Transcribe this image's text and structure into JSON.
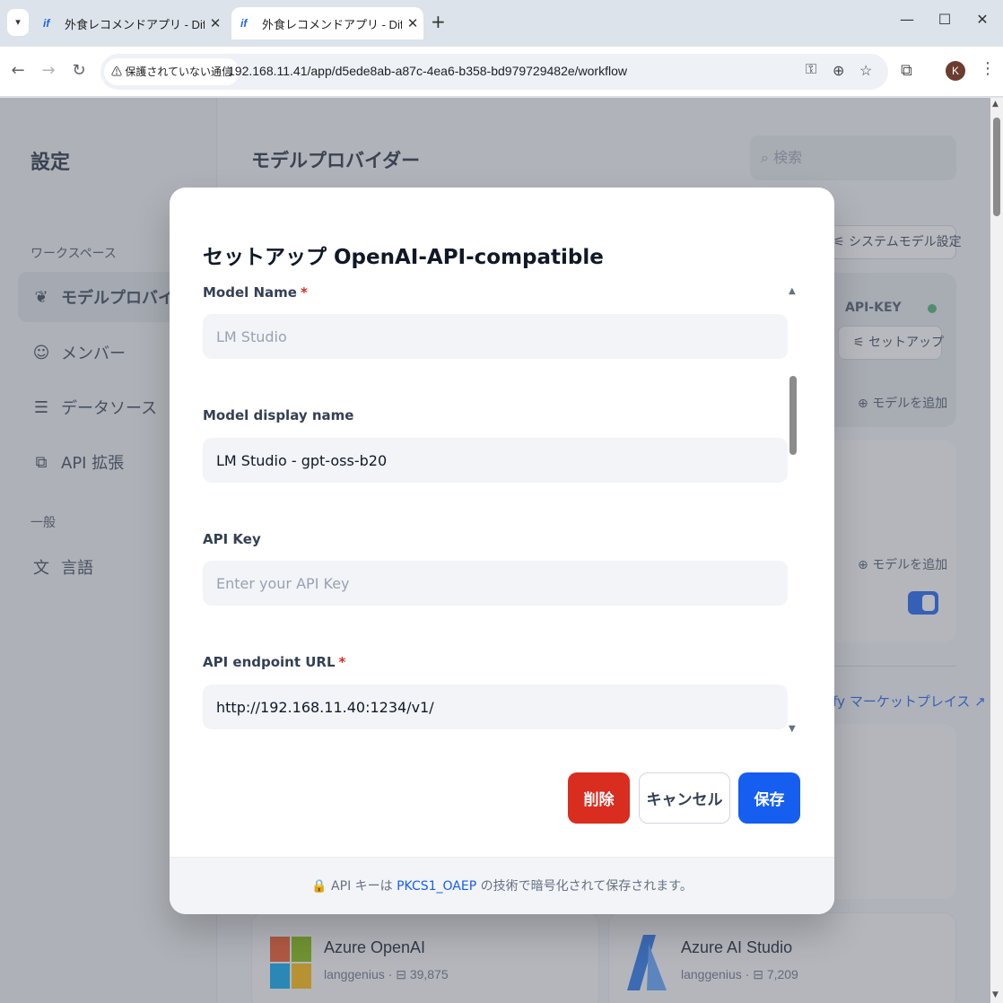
{
  "browser": {
    "tabs": [
      {
        "favicon": "if",
        "title": "外食レコメンドアプリ - Dify"
      },
      {
        "favicon": "if",
        "title": "外食レコメンドアプリ - Dify"
      }
    ],
    "security_label": "保護されていない通信",
    "url": "192.168.11.41/app/d5ede8ab-a87c-4ea6-b358-bd979729482e/workflow",
    "profile_initial": "K"
  },
  "sidebar": {
    "title": "設定",
    "workspace_label": "ワークスペース",
    "items": [
      {
        "icon": "brain-icon",
        "label": "モデルプロバイダー"
      },
      {
        "icon": "members-icon",
        "label": "メンバー"
      },
      {
        "icon": "database-icon",
        "label": "データソース"
      },
      {
        "icon": "puzzle-icon",
        "label": "API 拡張"
      }
    ],
    "general_label": "一般",
    "general_items": [
      {
        "icon": "translate-icon",
        "label": "言語"
      }
    ]
  },
  "main": {
    "title": "モデルプロバイダー",
    "search_placeholder": "検索",
    "system_model_button": "システムモデル設定",
    "api_key_label": "API-KEY",
    "setup_button": "セットアップ",
    "add_model_1": "モデルを追加",
    "add_model_2": "モデルを追加",
    "marketplace_link": "ify マーケットプレイス ↗",
    "providers": [
      {
        "name": "Azure OpenAI",
        "author": "langgenius",
        "installs": "39,875"
      },
      {
        "name": "Azure AI Studio",
        "author": "langgenius",
        "installs": "7,209"
      }
    ]
  },
  "modal": {
    "title": "セットアップ OpenAI-API-compatible",
    "fields": [
      {
        "label": "Model Name",
        "required": "*",
        "value": "",
        "placeholder": "LM Studio"
      },
      {
        "label": "Model display name",
        "required": "",
        "value": "LM Studio - gpt-oss-b20",
        "placeholder": ""
      },
      {
        "label": "API Key",
        "required": "",
        "value": "",
        "placeholder": "Enter your API Key"
      },
      {
        "label": "API endpoint URL",
        "required": "*",
        "value": "http://192.168.11.40:1234/v1/",
        "placeholder": ""
      }
    ],
    "buttons": {
      "delete": "削除",
      "cancel": "キャンセル",
      "save": "保存"
    },
    "footer": {
      "prefix": "API キーは",
      "link": "PKCS1_OAEP",
      "suffix": "の技術で暗号化されて保存されます。"
    }
  },
  "colors": {
    "primary": "#155eef",
    "danger": "#d92d20",
    "required": "#d92d20",
    "status_ok": "#47b06e"
  }
}
